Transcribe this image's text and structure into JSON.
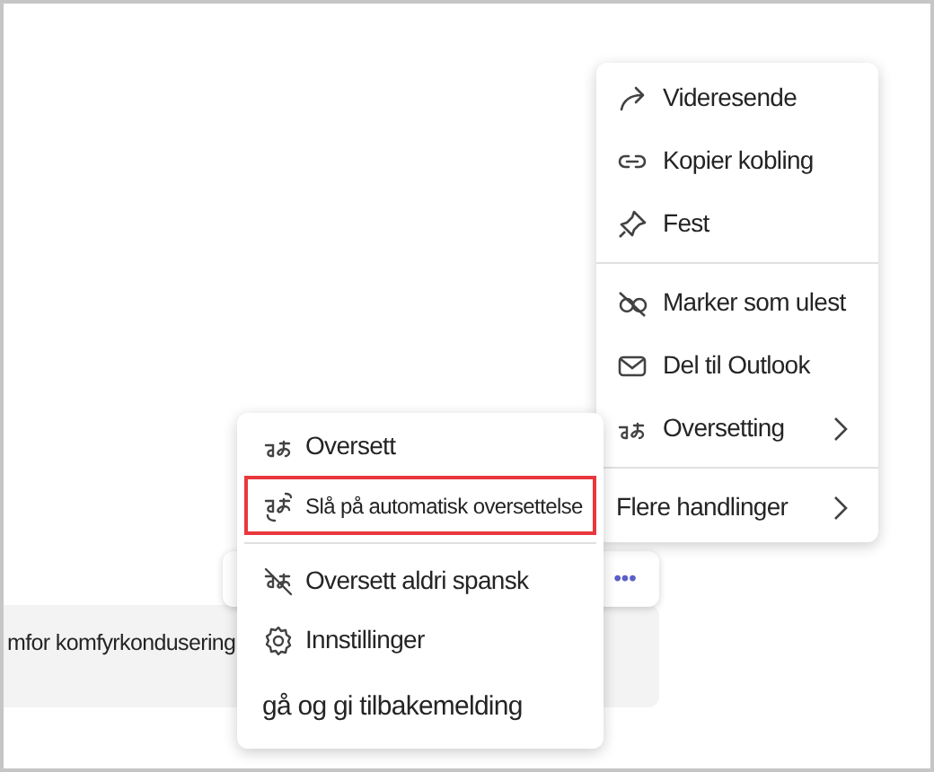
{
  "message": {
    "text": "mfor komfyrkondusering"
  },
  "reaction_bar": {
    "more": "•••"
  },
  "main_menu": {
    "groups": [
      [
        {
          "label": "Videresende",
          "kind": "forward",
          "submenu": false
        },
        {
          "label": "Kopier kobling",
          "kind": "link",
          "submenu": false
        },
        {
          "label": "Fest",
          "kind": "pin",
          "submenu": false
        }
      ],
      [
        {
          "label": "Marker som ulest",
          "kind": "unread",
          "submenu": false
        },
        {
          "label": "Del til Outlook",
          "kind": "mail",
          "submenu": false
        },
        {
          "label": "Oversetting",
          "kind": "translate",
          "submenu": true
        }
      ],
      [
        {
          "label": "Flere handlinger",
          "kind": "plain",
          "submenu": true
        }
      ]
    ]
  },
  "submenu": {
    "groups": [
      [
        {
          "label": "Oversett",
          "kind": "translate",
          "highlighted": false
        },
        {
          "label": "Slå på automatisk oversettelse",
          "kind": "auto-translate",
          "highlighted": true
        }
      ],
      [
        {
          "label": "Oversett aldri spansk",
          "kind": "no-translate",
          "highlighted": false
        },
        {
          "label": "Innstillinger",
          "kind": "settings",
          "highlighted": false
        },
        {
          "label": "gå og gi tilbakemelding",
          "kind": "feedback",
          "highlighted": false
        }
      ]
    ]
  }
}
